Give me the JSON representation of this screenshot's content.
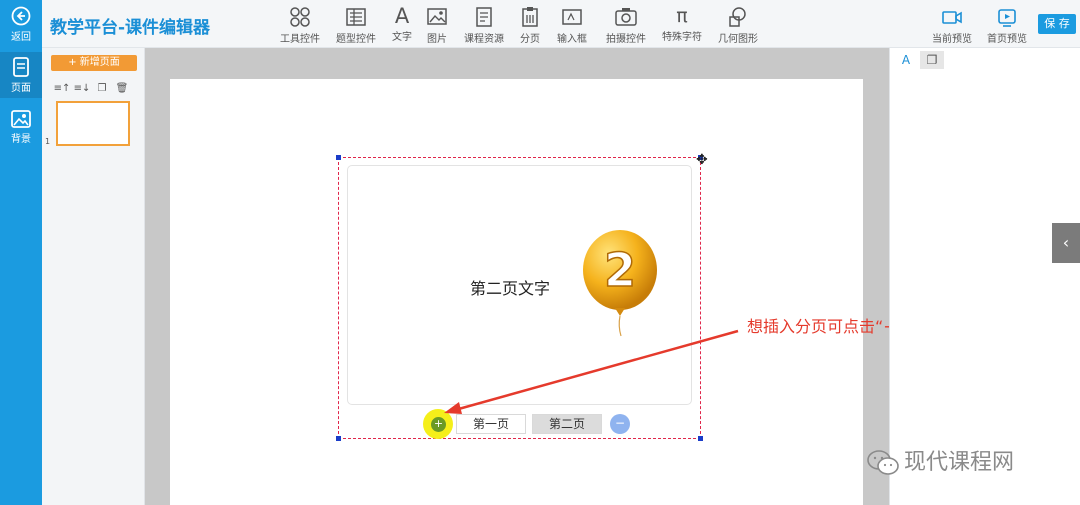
{
  "app": {
    "title": "教学平台-课件编辑器"
  },
  "rail": {
    "back_label": "返回",
    "pages_label": "页面",
    "background_label": "背景"
  },
  "toolbar": {
    "tools": [
      "工具控件",
      "题型控件",
      "文字",
      "图片",
      "课程资源",
      "分页",
      "输入框",
      "拍摄控件",
      "特殊字符",
      "几何图形"
    ],
    "preview_current": "当前预览",
    "preview_home": "首页预览",
    "save_label": "保 存",
    "special_char_glyph": "π",
    "text_glyph": "A"
  },
  "pages_panel": {
    "new_page_label": "+ 新增页面",
    "tool_icons": [
      "move-up-icon",
      "move-down-icon",
      "copy-icon",
      "trash-icon"
    ],
    "page_number": "1"
  },
  "widget": {
    "page_text": "第二页文字",
    "balloon_number": "2",
    "add_tab_label": "+",
    "tabs": [
      {
        "label": "第一页",
        "active": false
      },
      {
        "label": "第二页",
        "active": true
      }
    ],
    "remove_tab_label": "−",
    "move_handle_glyph": "✥"
  },
  "annotation": {
    "text": "想插入分页可点击“+”添加"
  },
  "props_panel": {
    "text_tab": "A"
  },
  "watermark": {
    "text": "现代课程网"
  },
  "colors": {
    "rail": "#1b9be0",
    "accent": "#1b8fd6",
    "new_page": "#f29a35",
    "selection": "#e0264a",
    "annotation": "#e53a2c"
  }
}
